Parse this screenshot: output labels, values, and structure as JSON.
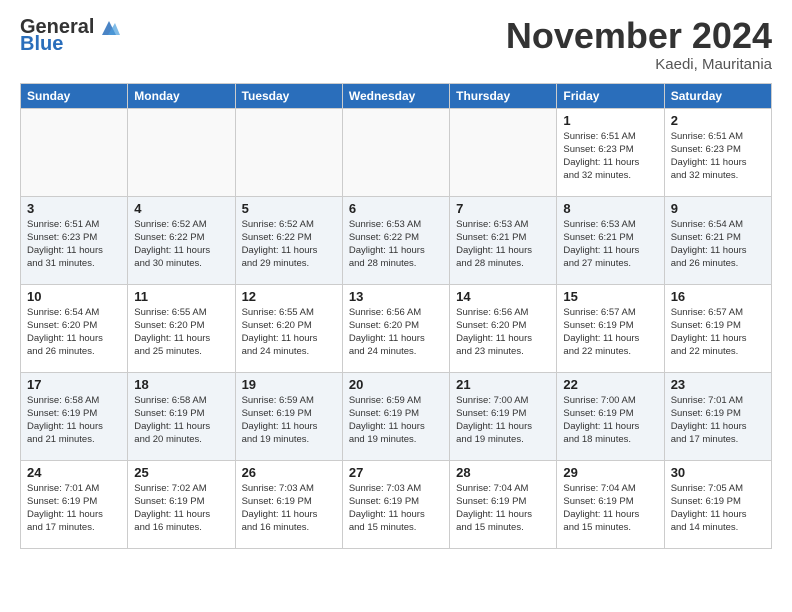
{
  "header": {
    "logo_general": "General",
    "logo_blue": "Blue",
    "month_title": "November 2024",
    "location": "Kaedi, Mauritania"
  },
  "days_of_week": [
    "Sunday",
    "Monday",
    "Tuesday",
    "Wednesday",
    "Thursday",
    "Friday",
    "Saturday"
  ],
  "weeks": [
    [
      {
        "day": "",
        "info": ""
      },
      {
        "day": "",
        "info": ""
      },
      {
        "day": "",
        "info": ""
      },
      {
        "day": "",
        "info": ""
      },
      {
        "day": "",
        "info": ""
      },
      {
        "day": "1",
        "info": "Sunrise: 6:51 AM\nSunset: 6:23 PM\nDaylight: 11 hours\nand 32 minutes."
      },
      {
        "day": "2",
        "info": "Sunrise: 6:51 AM\nSunset: 6:23 PM\nDaylight: 11 hours\nand 32 minutes."
      }
    ],
    [
      {
        "day": "3",
        "info": "Sunrise: 6:51 AM\nSunset: 6:23 PM\nDaylight: 11 hours\nand 31 minutes."
      },
      {
        "day": "4",
        "info": "Sunrise: 6:52 AM\nSunset: 6:22 PM\nDaylight: 11 hours\nand 30 minutes."
      },
      {
        "day": "5",
        "info": "Sunrise: 6:52 AM\nSunset: 6:22 PM\nDaylight: 11 hours\nand 29 minutes."
      },
      {
        "day": "6",
        "info": "Sunrise: 6:53 AM\nSunset: 6:22 PM\nDaylight: 11 hours\nand 28 minutes."
      },
      {
        "day": "7",
        "info": "Sunrise: 6:53 AM\nSunset: 6:21 PM\nDaylight: 11 hours\nand 28 minutes."
      },
      {
        "day": "8",
        "info": "Sunrise: 6:53 AM\nSunset: 6:21 PM\nDaylight: 11 hours\nand 27 minutes."
      },
      {
        "day": "9",
        "info": "Sunrise: 6:54 AM\nSunset: 6:21 PM\nDaylight: 11 hours\nand 26 minutes."
      }
    ],
    [
      {
        "day": "10",
        "info": "Sunrise: 6:54 AM\nSunset: 6:20 PM\nDaylight: 11 hours\nand 26 minutes."
      },
      {
        "day": "11",
        "info": "Sunrise: 6:55 AM\nSunset: 6:20 PM\nDaylight: 11 hours\nand 25 minutes."
      },
      {
        "day": "12",
        "info": "Sunrise: 6:55 AM\nSunset: 6:20 PM\nDaylight: 11 hours\nand 24 minutes."
      },
      {
        "day": "13",
        "info": "Sunrise: 6:56 AM\nSunset: 6:20 PM\nDaylight: 11 hours\nand 24 minutes."
      },
      {
        "day": "14",
        "info": "Sunrise: 6:56 AM\nSunset: 6:20 PM\nDaylight: 11 hours\nand 23 minutes."
      },
      {
        "day": "15",
        "info": "Sunrise: 6:57 AM\nSunset: 6:19 PM\nDaylight: 11 hours\nand 22 minutes."
      },
      {
        "day": "16",
        "info": "Sunrise: 6:57 AM\nSunset: 6:19 PM\nDaylight: 11 hours\nand 22 minutes."
      }
    ],
    [
      {
        "day": "17",
        "info": "Sunrise: 6:58 AM\nSunset: 6:19 PM\nDaylight: 11 hours\nand 21 minutes."
      },
      {
        "day": "18",
        "info": "Sunrise: 6:58 AM\nSunset: 6:19 PM\nDaylight: 11 hours\nand 20 minutes."
      },
      {
        "day": "19",
        "info": "Sunrise: 6:59 AM\nSunset: 6:19 PM\nDaylight: 11 hours\nand 19 minutes."
      },
      {
        "day": "20",
        "info": "Sunrise: 6:59 AM\nSunset: 6:19 PM\nDaylight: 11 hours\nand 19 minutes."
      },
      {
        "day": "21",
        "info": "Sunrise: 7:00 AM\nSunset: 6:19 PM\nDaylight: 11 hours\nand 19 minutes."
      },
      {
        "day": "22",
        "info": "Sunrise: 7:00 AM\nSunset: 6:19 PM\nDaylight: 11 hours\nand 18 minutes."
      },
      {
        "day": "23",
        "info": "Sunrise: 7:01 AM\nSunset: 6:19 PM\nDaylight: 11 hours\nand 17 minutes."
      }
    ],
    [
      {
        "day": "24",
        "info": "Sunrise: 7:01 AM\nSunset: 6:19 PM\nDaylight: 11 hours\nand 17 minutes."
      },
      {
        "day": "25",
        "info": "Sunrise: 7:02 AM\nSunset: 6:19 PM\nDaylight: 11 hours\nand 16 minutes."
      },
      {
        "day": "26",
        "info": "Sunrise: 7:03 AM\nSunset: 6:19 PM\nDaylight: 11 hours\nand 16 minutes."
      },
      {
        "day": "27",
        "info": "Sunrise: 7:03 AM\nSunset: 6:19 PM\nDaylight: 11 hours\nand 15 minutes."
      },
      {
        "day": "28",
        "info": "Sunrise: 7:04 AM\nSunset: 6:19 PM\nDaylight: 11 hours\nand 15 minutes."
      },
      {
        "day": "29",
        "info": "Sunrise: 7:04 AM\nSunset: 6:19 PM\nDaylight: 11 hours\nand 15 minutes."
      },
      {
        "day": "30",
        "info": "Sunrise: 7:05 AM\nSunset: 6:19 PM\nDaylight: 11 hours\nand 14 minutes."
      }
    ]
  ]
}
